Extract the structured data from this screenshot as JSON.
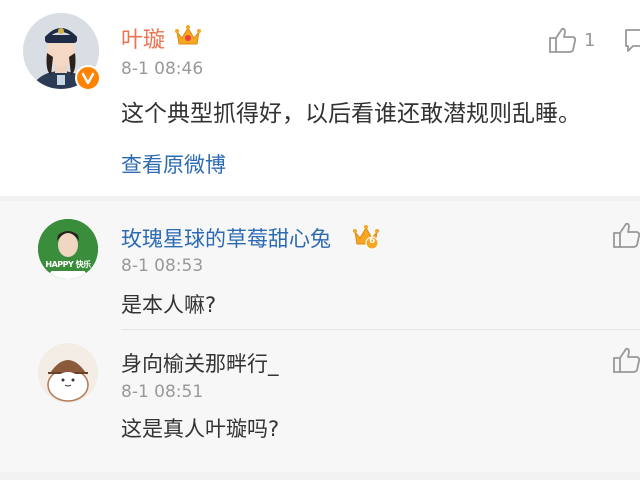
{
  "main_comment": {
    "author": "叶璇",
    "timestamp": "8-1 08:46",
    "text": "这个典型抓得好，以后看谁还敢潜规则乱睡。",
    "like_count": "1",
    "view_original_link": "查看原微博",
    "avatar_icon": "police-officer-avatar",
    "verified_icon": "verified-v-badge"
  },
  "replies": [
    {
      "author": "玫瑰星球的草莓甜心兔",
      "timestamp": "8-1 08:53",
      "text": "是本人嘛?",
      "level_badge": "6",
      "avatar_icon": "green-photo-avatar",
      "avatar_text": "HAPPY 快乐"
    },
    {
      "author": "身向榆关那畔行_",
      "timestamp": "8-1 08:51",
      "text": "这是真人叶璇吗?",
      "avatar_icon": "cartoon-cat-avatar"
    }
  ],
  "colors": {
    "author_primary": "#eb7350",
    "author_reply": "#2c6bb4",
    "link": "#2c6bb4",
    "timestamp": "#999999",
    "background": "#f2f2f2"
  }
}
